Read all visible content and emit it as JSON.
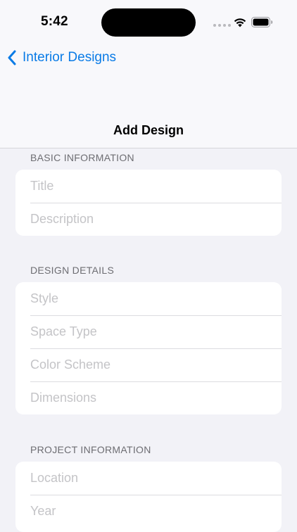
{
  "status_bar": {
    "time": "5:42"
  },
  "nav": {
    "back_label": "Interior Designs",
    "title": "Add Design"
  },
  "sections": [
    {
      "header": "BASIC INFORMATION",
      "fields": [
        {
          "placeholder": "Title",
          "value": ""
        },
        {
          "placeholder": "Description",
          "value": ""
        }
      ]
    },
    {
      "header": "DESIGN DETAILS",
      "fields": [
        {
          "placeholder": "Style",
          "value": ""
        },
        {
          "placeholder": "Space Type",
          "value": ""
        },
        {
          "placeholder": "Color Scheme",
          "value": ""
        },
        {
          "placeholder": "Dimensions",
          "value": ""
        }
      ]
    },
    {
      "header": "PROJECT INFORMATION",
      "fields": [
        {
          "placeholder": "Location",
          "value": ""
        },
        {
          "placeholder": "Year",
          "value": ""
        }
      ]
    }
  ],
  "colors": {
    "accent": "#0a7be6",
    "background": "#f2f2f7",
    "placeholder": "#c4c4c7",
    "section_header": "#6d6d72"
  },
  "icons": {
    "back": "chevron-left-icon",
    "wifi": "wifi-icon",
    "battery": "battery-icon",
    "signal": "signal-icon"
  }
}
